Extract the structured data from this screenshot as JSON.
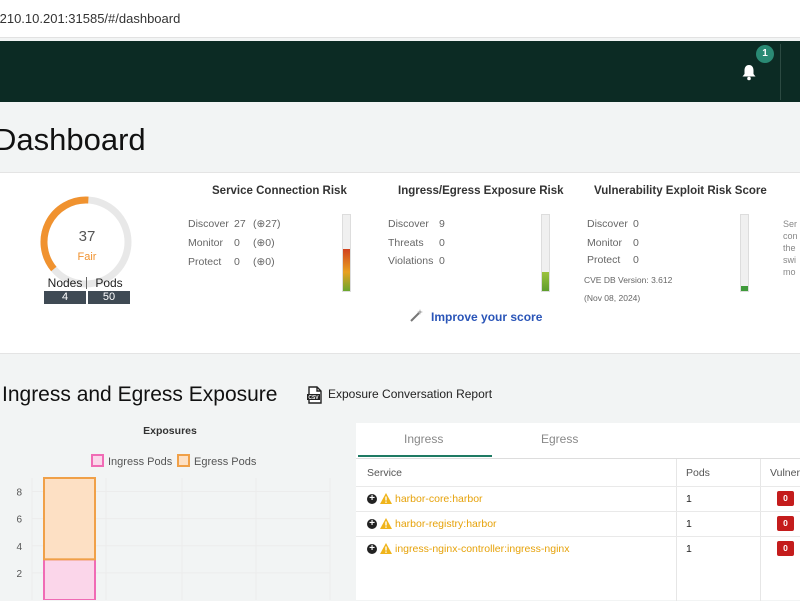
{
  "browser": {
    "url": ".210.10.201:31585/#/dashboard"
  },
  "header": {
    "notification_count": "1"
  },
  "page_title": "Dashboard",
  "score": {
    "value": "37",
    "rating": "Fair",
    "gauge_fraction": 0.37,
    "nodes_label": "Nodes",
    "nodes_value": "4",
    "pods_label": "Pods",
    "pods_value": "50"
  },
  "service_connection": {
    "title": "Service Connection Risk",
    "rows": [
      {
        "label": "Discover",
        "value": "27",
        "extra": "(⊕27)"
      },
      {
        "label": "Monitor",
        "value": "0",
        "extra": "(⊕0)"
      },
      {
        "label": "Protect",
        "value": "0",
        "extra": "(⊕0)"
      }
    ],
    "meter_fraction": 0.55
  },
  "ingress_egress": {
    "title": "Ingress/Egress Exposure Risk",
    "rows": [
      {
        "label": "Discover",
        "value": "9"
      },
      {
        "label": "Threats",
        "value": "0"
      },
      {
        "label": "Violations",
        "value": "0"
      }
    ],
    "meter_fraction": 0.25
  },
  "vulnerability": {
    "title": "Vulnerability Exploit Risk Score",
    "rows": [
      {
        "label": "Discover",
        "value": "0"
      },
      {
        "label": "Monitor",
        "value": "0"
      },
      {
        "label": "Protect",
        "value": "0"
      }
    ],
    "cve_version": "CVE DB Version: 3.612",
    "cve_date": "(Nov 08, 2024)",
    "meter_fraction": 0.06
  },
  "improve_link": "Improve your score",
  "side_text": [
    "Ser",
    "con",
    "the",
    "swi",
    "mo"
  ],
  "exposure_section": {
    "title": "Ingress and Egress Exposure",
    "report_link": "Exposure Conversation Report"
  },
  "colors": {
    "ingress": "#f06bb5",
    "egress": "#f0a048",
    "brand_dark": "#0c2b24",
    "accent": "#1e7a63"
  },
  "chart_data": {
    "type": "bar",
    "title": "Exposures",
    "stacked": true,
    "categories": [
      ""
    ],
    "series": [
      {
        "name": "Ingress Pods",
        "values": [
          3
        ]
      },
      {
        "name": "Egress Pods",
        "values": [
          6
        ]
      }
    ],
    "yticks": [
      2,
      4,
      6,
      8
    ],
    "ylim": [
      0,
      9
    ]
  },
  "tabs": [
    "Ingress",
    "Egress"
  ],
  "table": {
    "headers": [
      "Service",
      "Pods",
      "Vulner"
    ],
    "rows": [
      {
        "service": "harbor-core:harbor",
        "pods": "1",
        "vuln": "0"
      },
      {
        "service": "harbor-registry:harbor",
        "pods": "1",
        "vuln": "0"
      },
      {
        "service": "ingress-nginx-controller:ingress-nginx",
        "pods": "1",
        "vuln": "0"
      }
    ]
  }
}
